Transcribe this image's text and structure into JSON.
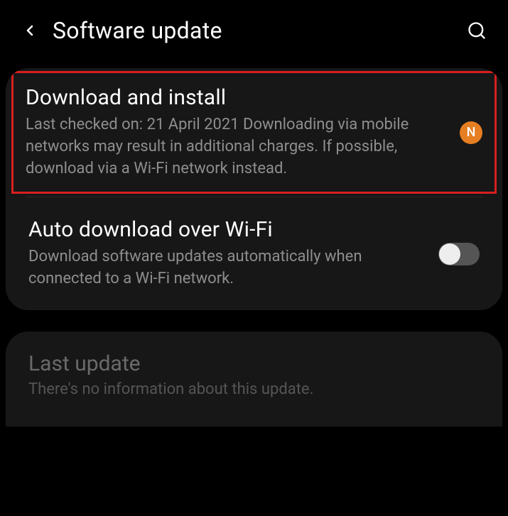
{
  "header": {
    "title": "Software update"
  },
  "items": {
    "download": {
      "title": "Download and install",
      "desc": "Last checked on: 21 April 2021\nDownloading via mobile networks may result in additional charges. If possible, download via a Wi-Fi network instead.",
      "badge": "N"
    },
    "auto": {
      "title": "Auto download over Wi-Fi",
      "desc": "Download software updates automatically when connected to a Wi-Fi network."
    },
    "last": {
      "title": "Last update",
      "desc": "There's no information about this update."
    }
  }
}
